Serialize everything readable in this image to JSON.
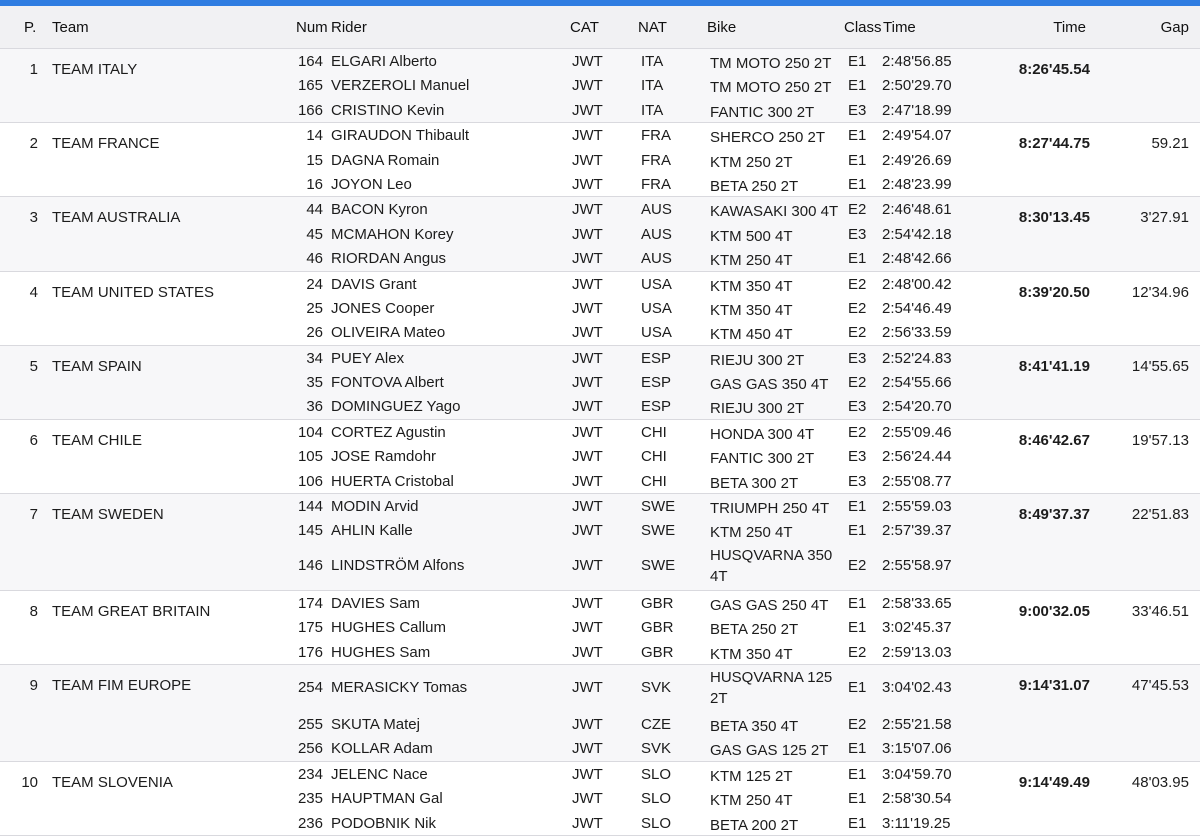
{
  "accent_color": "#2f7de1",
  "headers": {
    "pos": "P.",
    "team": "Team",
    "num": "Num",
    "rider": "Rider",
    "cat": "CAT",
    "nat": "NAT",
    "bike": "Bike",
    "class": "Class",
    "rider_time": "Time",
    "time": "Time",
    "gap": "Gap"
  },
  "teams": [
    {
      "pos": "1",
      "name": "TEAM ITALY",
      "time": "8:26'45.54",
      "gap": "",
      "riders": [
        {
          "num": "164",
          "rider": "ELGARI Alberto",
          "cat": "JWT",
          "nat": "ITA",
          "bike": "TM MOTO 250 2T",
          "class": "E1",
          "time": "2:48'56.85"
        },
        {
          "num": "165",
          "rider": "VERZEROLI Manuel",
          "cat": "JWT",
          "nat": "ITA",
          "bike": "TM MOTO 250 2T",
          "class": "E1",
          "time": "2:50'29.70"
        },
        {
          "num": "166",
          "rider": "CRISTINO Kevin",
          "cat": "JWT",
          "nat": "ITA",
          "bike": "FANTIC 300 2T",
          "class": "E3",
          "time": "2:47'18.99"
        }
      ]
    },
    {
      "pos": "2",
      "name": "TEAM FRANCE",
      "time": "8:27'44.75",
      "gap": "59.21",
      "riders": [
        {
          "num": "14",
          "rider": "GIRAUDON Thibault",
          "cat": "JWT",
          "nat": "FRA",
          "bike": "SHERCO 250 2T",
          "class": "E1",
          "time": "2:49'54.07"
        },
        {
          "num": "15",
          "rider": "DAGNA Romain",
          "cat": "JWT",
          "nat": "FRA",
          "bike": "KTM 250 2T",
          "class": "E1",
          "time": "2:49'26.69"
        },
        {
          "num": "16",
          "rider": "JOYON Leo",
          "cat": "JWT",
          "nat": "FRA",
          "bike": "BETA 250 2T",
          "class": "E1",
          "time": "2:48'23.99"
        }
      ]
    },
    {
      "pos": "3",
      "name": "TEAM AUSTRALIA",
      "time": "8:30'13.45",
      "gap": "3'27.91",
      "riders": [
        {
          "num": "44",
          "rider": "BACON Kyron",
          "cat": "JWT",
          "nat": "AUS",
          "bike": "KAWASAKI 300 4T",
          "class": "E2",
          "time": "2:46'48.61"
        },
        {
          "num": "45",
          "rider": "MCMAHON Korey",
          "cat": "JWT",
          "nat": "AUS",
          "bike": "KTM 500 4T",
          "class": "E3",
          "time": "2:54'42.18"
        },
        {
          "num": "46",
          "rider": "RIORDAN Angus",
          "cat": "JWT",
          "nat": "AUS",
          "bike": "KTM 250 4T",
          "class": "E1",
          "time": "2:48'42.66"
        }
      ]
    },
    {
      "pos": "4",
      "name": "TEAM UNITED STATES",
      "time": "8:39'20.50",
      "gap": "12'34.96",
      "riders": [
        {
          "num": "24",
          "rider": "DAVIS Grant",
          "cat": "JWT",
          "nat": "USA",
          "bike": "KTM 350 4T",
          "class": "E2",
          "time": "2:48'00.42"
        },
        {
          "num": "25",
          "rider": "JONES Cooper",
          "cat": "JWT",
          "nat": "USA",
          "bike": "KTM 350 4T",
          "class": "E2",
          "time": "2:54'46.49"
        },
        {
          "num": "26",
          "rider": "OLIVEIRA Mateo",
          "cat": "JWT",
          "nat": "USA",
          "bike": "KTM 450 4T",
          "class": "E2",
          "time": "2:56'33.59"
        }
      ]
    },
    {
      "pos": "5",
      "name": "TEAM SPAIN",
      "time": "8:41'41.19",
      "gap": "14'55.65",
      "riders": [
        {
          "num": "34",
          "rider": "PUEY Alex",
          "cat": "JWT",
          "nat": "ESP",
          "bike": "RIEJU 300 2T",
          "class": "E3",
          "time": "2:52'24.83"
        },
        {
          "num": "35",
          "rider": "FONTOVA Albert",
          "cat": "JWT",
          "nat": "ESP",
          "bike": "GAS GAS 350 4T",
          "class": "E2",
          "time": "2:54'55.66"
        },
        {
          "num": "36",
          "rider": "DOMINGUEZ Yago",
          "cat": "JWT",
          "nat": "ESP",
          "bike": "RIEJU 300 2T",
          "class": "E3",
          "time": "2:54'20.70"
        }
      ]
    },
    {
      "pos": "6",
      "name": "TEAM CHILE",
      "time": "8:46'42.67",
      "gap": "19'57.13",
      "riders": [
        {
          "num": "104",
          "rider": "CORTEZ Agustin",
          "cat": "JWT",
          "nat": "CHI",
          "bike": "HONDA 300 4T",
          "class": "E2",
          "time": "2:55'09.46"
        },
        {
          "num": "105",
          "rider": "JOSE Ramdohr",
          "cat": "JWT",
          "nat": "CHI",
          "bike": "FANTIC 300 2T",
          "class": "E3",
          "time": "2:56'24.44"
        },
        {
          "num": "106",
          "rider": "HUERTA Cristobal",
          "cat": "JWT",
          "nat": "CHI",
          "bike": "BETA 300 2T",
          "class": "E3",
          "time": "2:55'08.77"
        }
      ]
    },
    {
      "pos": "7",
      "name": "TEAM SWEDEN",
      "time": "8:49'37.37",
      "gap": "22'51.83",
      "riders": [
        {
          "num": "144",
          "rider": "MODIN Arvid",
          "cat": "JWT",
          "nat": "SWE",
          "bike": "TRIUMPH 250 4T",
          "class": "E1",
          "time": "2:55'59.03"
        },
        {
          "num": "145",
          "rider": "AHLIN Kalle",
          "cat": "JWT",
          "nat": "SWE",
          "bike": "KTM 250 4T",
          "class": "E1",
          "time": "2:57'39.37"
        },
        {
          "num": "146",
          "rider": "LINDSTRÖM Alfons",
          "cat": "JWT",
          "nat": "SWE",
          "bike": "HUSQVARNA 350 4T",
          "class": "E2",
          "time": "2:55'58.97",
          "tall": true
        }
      ]
    },
    {
      "pos": "8",
      "name": "TEAM GREAT BRITAIN",
      "time": "9:00'32.05",
      "gap": "33'46.51",
      "riders": [
        {
          "num": "174",
          "rider": "DAVIES Sam",
          "cat": "JWT",
          "nat": "GBR",
          "bike": "GAS GAS 250 4T",
          "class": "E1",
          "time": "2:58'33.65"
        },
        {
          "num": "175",
          "rider": "HUGHES Callum",
          "cat": "JWT",
          "nat": "GBR",
          "bike": "BETA 250 2T",
          "class": "E1",
          "time": "3:02'45.37"
        },
        {
          "num": "176",
          "rider": "HUGHES Sam",
          "cat": "JWT",
          "nat": "GBR",
          "bike": "KTM 350 4T",
          "class": "E2",
          "time": "2:59'13.03"
        }
      ]
    },
    {
      "pos": "9",
      "name": "TEAM FIM EUROPE",
      "time": "9:14'31.07",
      "gap": "47'45.53",
      "riders": [
        {
          "num": "254",
          "rider": "MERASICKY Tomas",
          "cat": "JWT",
          "nat": "SVK",
          "bike": "HUSQVARNA 125 2T",
          "class": "E1",
          "time": "3:04'02.43",
          "tall": true
        },
        {
          "num": "255",
          "rider": "SKUTA Matej",
          "cat": "JWT",
          "nat": "CZE",
          "bike": "BETA 350 4T",
          "class": "E2",
          "time": "2:55'21.58"
        },
        {
          "num": "256",
          "rider": "KOLLAR Adam",
          "cat": "JWT",
          "nat": "SVK",
          "bike": "GAS GAS 125 2T",
          "class": "E1",
          "time": "3:15'07.06"
        }
      ]
    },
    {
      "pos": "10",
      "name": "TEAM SLOVENIA",
      "time": "9:14'49.49",
      "gap": "48'03.95",
      "riders": [
        {
          "num": "234",
          "rider": "JELENC Nace",
          "cat": "JWT",
          "nat": "SLO",
          "bike": "KTM 125 2T",
          "class": "E1",
          "time": "3:04'59.70"
        },
        {
          "num": "235",
          "rider": "HAUPTMAN Gal",
          "cat": "JWT",
          "nat": "SLO",
          "bike": "KTM 250 4T",
          "class": "E1",
          "time": "2:58'30.54"
        },
        {
          "num": "236",
          "rider": "PODOBNIK Nik",
          "cat": "JWT",
          "nat": "SLO",
          "bike": "BETA 200 2T",
          "class": "E1",
          "time": "3:11'19.25"
        }
      ]
    }
  ]
}
